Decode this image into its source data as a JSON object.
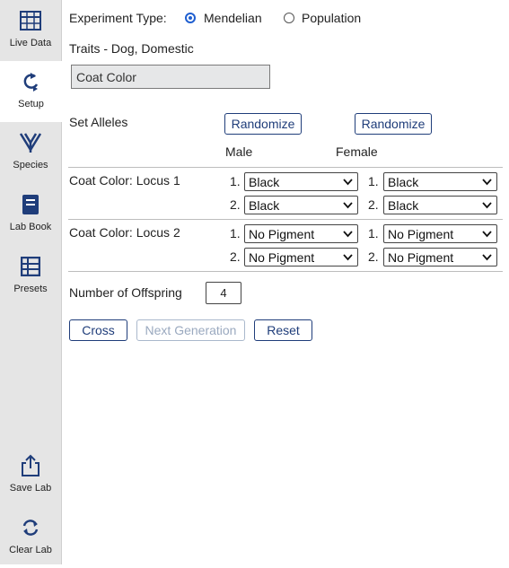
{
  "sidebar": {
    "items": [
      {
        "label": "Live Data",
        "icon": "table-icon"
      },
      {
        "label": "Setup",
        "icon": "setup-refresh-icon"
      },
      {
        "label": "Species",
        "icon": "species-icon"
      },
      {
        "label": "Lab Book",
        "icon": "lab-book-icon"
      },
      {
        "label": "Presets",
        "icon": "presets-icon"
      },
      {
        "label": "Save Lab",
        "icon": "share-icon"
      },
      {
        "label": "Clear Lab",
        "icon": "clear-icon"
      }
    ]
  },
  "experiment": {
    "label": "Experiment Type:",
    "options": [
      "Mendelian",
      "Population"
    ],
    "selected": "Mendelian"
  },
  "traits": {
    "title": "Traits - Dog, Domestic",
    "selected": "Coat Color"
  },
  "alleles": {
    "title": "Set Alleles",
    "randomize_label": "Randomize",
    "male_label": "Male",
    "female_label": "Female",
    "loci": [
      {
        "label": "Coat Color: Locus 1",
        "male": [
          "Black",
          "Black"
        ],
        "female": [
          "Black",
          "Black"
        ]
      },
      {
        "label": "Coat Color: Locus 2",
        "male": [
          "No Pigment",
          "No Pigment"
        ],
        "female": [
          "No Pigment",
          "No Pigment"
        ]
      }
    ],
    "index_labels": [
      "1.",
      "2."
    ]
  },
  "offspring": {
    "label": "Number of Offspring",
    "value": "4"
  },
  "actions": {
    "cross": "Cross",
    "next_generation": "Next Generation",
    "reset": "Reset"
  },
  "colors": {
    "accent": "#1f5fd0",
    "button_border": "#1f3d7a",
    "sidebar_bg": "#e5e5e5"
  }
}
